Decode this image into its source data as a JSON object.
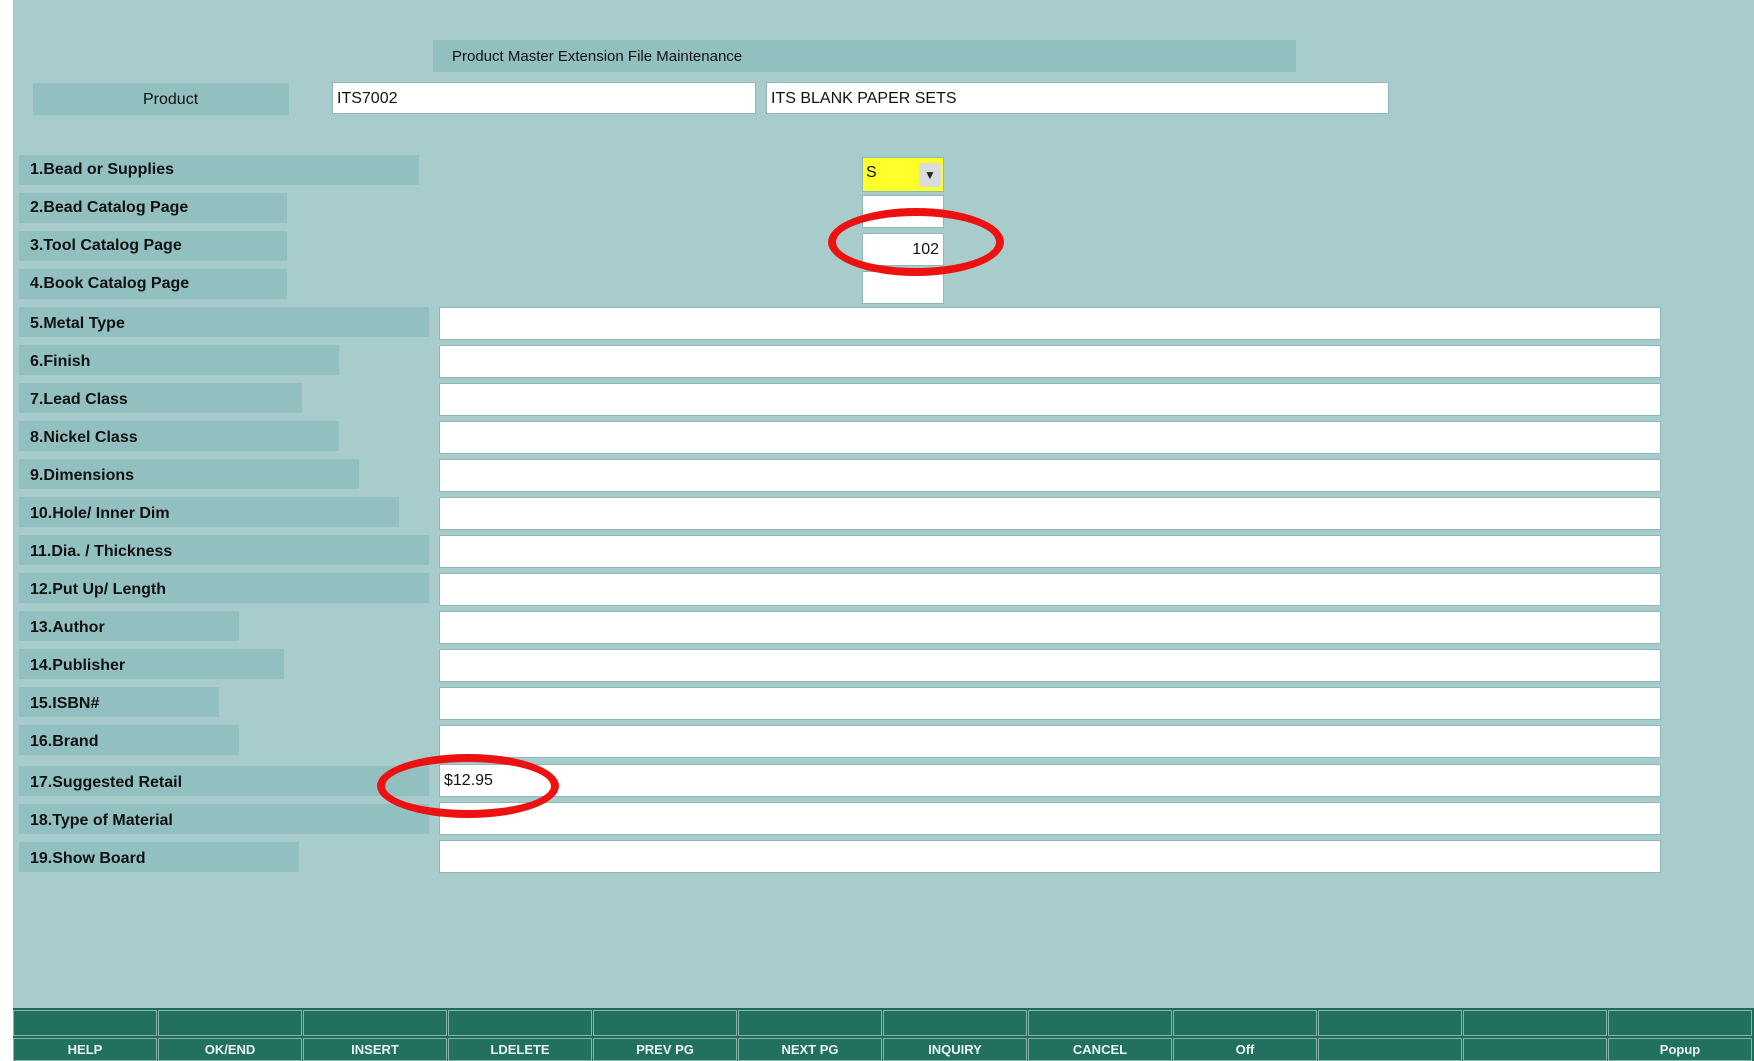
{
  "title": "Product Master Extension File Maintenance",
  "product": {
    "label": "Product",
    "code": "ITS7002",
    "description": "ITS BLANK PAPER SETS"
  },
  "fields": [
    {
      "label": "1.Bead or Supplies",
      "value": "S"
    },
    {
      "label": "2.Bead Catalog Page",
      "value": ""
    },
    {
      "label": "3.Tool Catalog Page",
      "value": "102"
    },
    {
      "label": "4.Book Catalog Page",
      "value": ""
    },
    {
      "label": "5.Metal Type",
      "value": ""
    },
    {
      "label": "6.Finish",
      "value": ""
    },
    {
      "label": "7.Lead Class",
      "value": ""
    },
    {
      "label": "8.Nickel Class",
      "value": ""
    },
    {
      "label": "9.Dimensions",
      "value": ""
    },
    {
      "label": "10.Hole/ Inner Dim",
      "value": ""
    },
    {
      "label": "11.Dia. / Thickness",
      "value": ""
    },
    {
      "label": "12.Put Up/ Length",
      "value": ""
    },
    {
      "label": "13.Author",
      "value": ""
    },
    {
      "label": "14.Publisher",
      "value": ""
    },
    {
      "label": "15.ISBN#",
      "value": ""
    },
    {
      "label": "16.Brand",
      "value": ""
    },
    {
      "label": "17.Suggested Retail",
      "value": "$12.95"
    },
    {
      "label": "18.Type of Material",
      "value": ""
    },
    {
      "label": "19.Show Board",
      "value": ""
    }
  ],
  "toolbar": {
    "buttons": [
      "HELP",
      "OK/END",
      "INSERT",
      "LDELETE",
      "PREV PG",
      "NEXT PG",
      "INQUIRY",
      "CANCEL",
      "Off",
      "",
      "",
      "Popup"
    ]
  },
  "colors": {
    "background": "#a8cbcb",
    "label_band": "#92c0c1",
    "highlight_field": "#ffff2a",
    "annotation_circle": "#ee1111",
    "toolbar": "#1f6b5b"
  }
}
